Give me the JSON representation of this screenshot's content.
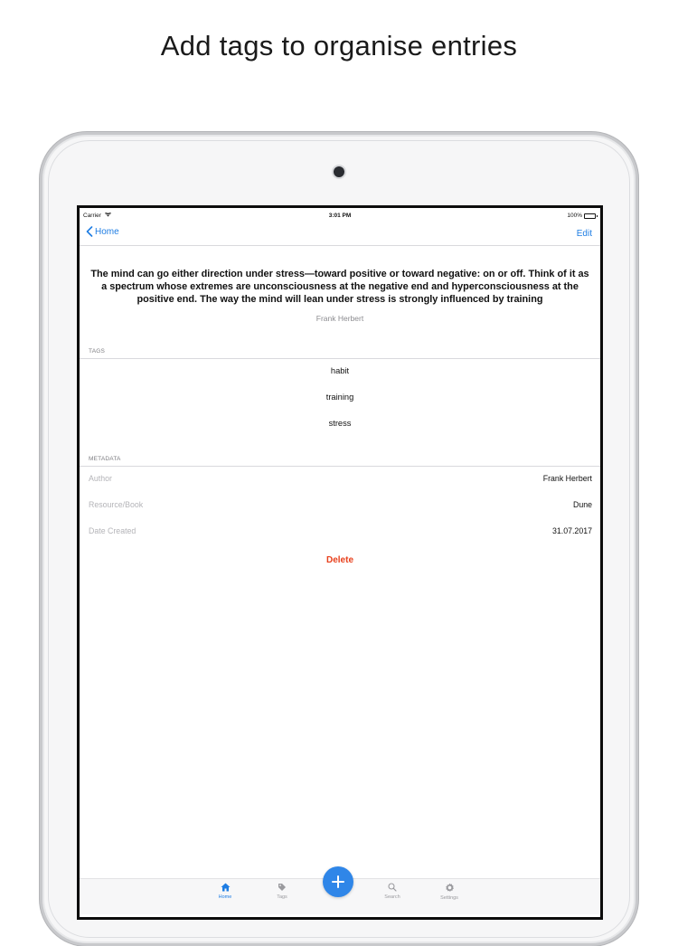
{
  "promo": {
    "headline": "Add tags to organise entries"
  },
  "status_bar": {
    "carrier": "Carrier",
    "time": "3:01 PM",
    "battery": "100%",
    "battery_level": 1.0
  },
  "nav": {
    "back_label": "Home",
    "edit_label": "Edit"
  },
  "entry": {
    "quote": "The mind can go either direction under stress—toward positive or toward negative: on or off. Think of it as a spectrum whose extremes are unconsciousness at the negative end and hyperconsciousness at the positive end. The way the mind will lean under stress is strongly influenced by training",
    "author": "Frank Herbert"
  },
  "tags_section": {
    "header": "TAGS",
    "items": [
      "habit",
      "training",
      "stress"
    ]
  },
  "metadata_section": {
    "header": "METADATA",
    "rows": [
      {
        "label": "Author",
        "value": "Frank Herbert"
      },
      {
        "label": "Resource/Book",
        "value": "Dune"
      },
      {
        "label": "Date Created",
        "value": "31.07.2017"
      }
    ]
  },
  "actions": {
    "delete_label": "Delete"
  },
  "tab_bar": {
    "tabs": [
      {
        "label": "Home",
        "icon": "home-icon",
        "active": true
      },
      {
        "label": "Tags",
        "icon": "tag-icon",
        "active": false
      },
      {
        "label": "Search",
        "icon": "search-icon",
        "active": false
      },
      {
        "label": "Settings",
        "icon": "gear-icon",
        "active": false
      }
    ],
    "add_icon": "plus-icon"
  },
  "colors": {
    "accent": "#1e7de3",
    "fab": "#2f86e8",
    "destructive": "#e8401c"
  }
}
